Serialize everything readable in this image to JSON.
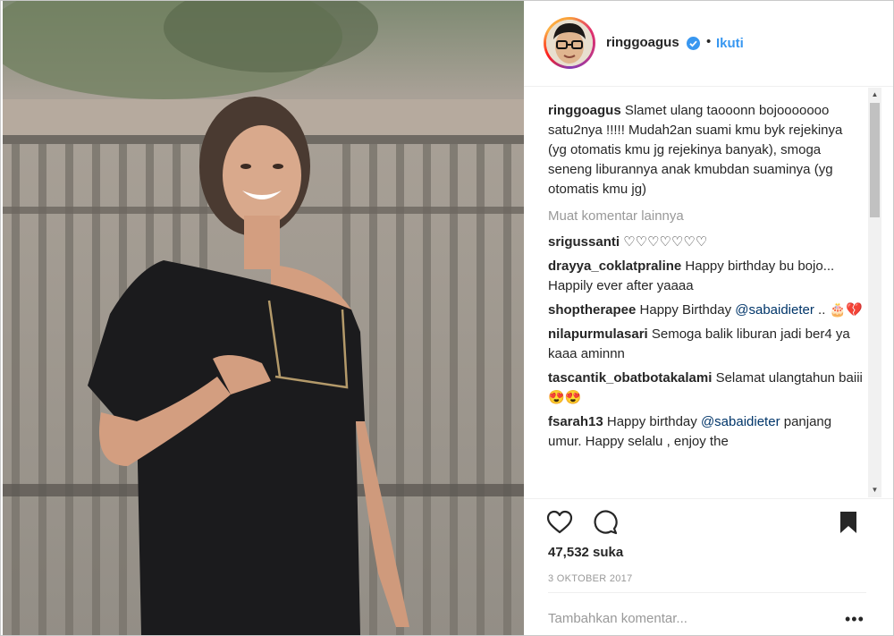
{
  "post": {
    "username": "ringgoagus",
    "verified_icon": "verified-badge-icon",
    "separator": "•",
    "follow_label": "Ikuti",
    "caption_user": "ringgoagus",
    "caption_text": " Slamet ulang taooonn bojooooooo satu2nya !!!!! Mudah2an suami kmu byk rejekinya (yg otomatis kmu jg rejekinya banyak), smoga seneng liburannya anak kmubdan suaminya (yg otomatis kmu jg)",
    "load_more_label": "Muat komentar lainnya",
    "comments": [
      {
        "user": "srigussanti",
        "text": " ♡♡♡♡♡♡♡"
      },
      {
        "user": "drayya_coklatpraline",
        "text": " Happy birthday bu bojo... Happily ever after yaaaa"
      },
      {
        "user": "shoptherapee",
        "text": " Happy Birthday ",
        "mention": "@sabaidieter",
        "text_after": " .. 🎂💔"
      },
      {
        "user": "nilapurmulasari",
        "text": " Semoga balik liburan jadi ber4 ya kaaa aminnn"
      },
      {
        "user": "tascantik_obatbotakalami",
        "text": " Selamat ulangtahun baiii😍😍"
      },
      {
        "user": "fsarah13",
        "text": " Happy birthday ",
        "mention": "@sabaidieter",
        "text_after": " panjang umur. Happy selalu , enjoy the"
      }
    ],
    "likes_label": "47,532 suka",
    "date_label": "3 OKTOBER 2017",
    "add_comment_placeholder": "Tambahkan komentar...",
    "more_options_label": "•••"
  },
  "icons": {
    "like": "heart-icon",
    "comment": "comment-icon",
    "save": "bookmark-icon"
  },
  "colors": {
    "link": "#3897f0",
    "muted": "#999999",
    "text": "#262626"
  }
}
